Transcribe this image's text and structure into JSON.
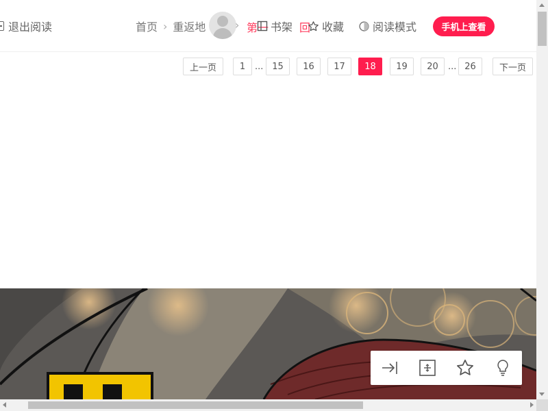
{
  "header": {
    "exit_label": "退出阅读",
    "breadcrumb": {
      "home": "首页",
      "title": "重返地",
      "chapter": "第一",
      "chapter_tail": "回"
    },
    "tools": {
      "shelf": "书架",
      "favorite": "收藏",
      "mode": "阅读模式"
    },
    "phone_button": "手机上查看"
  },
  "pagination": {
    "prev": "上一页",
    "next": "下一页",
    "dots": "...",
    "pages": [
      "1",
      "15",
      "16",
      "17",
      "18",
      "19",
      "20",
      "26"
    ],
    "current": "18"
  },
  "float_toolbar": {
    "icons": [
      "jump-to-end-icon",
      "fit-screen-icon",
      "star-icon",
      "lightbulb-icon"
    ]
  },
  "colors": {
    "accent": "#ff1d4e",
    "breadcrumb_active": "#ff3b5c"
  }
}
